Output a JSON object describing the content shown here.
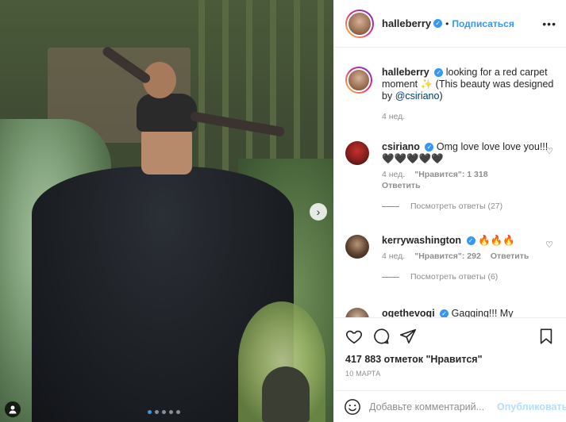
{
  "header": {
    "username": "halleberry",
    "separator": "•",
    "follow_label": "Подписаться",
    "more_label": "•••"
  },
  "caption": {
    "username": "halleberry",
    "text": "looking for a red carpet moment ✨ (This beauty was designed by ",
    "mention": "@csiriano",
    "text_end": ")",
    "time": "4 нед."
  },
  "comments": [
    {
      "username": "csiriano",
      "text": "Omg love love love you!!! 🖤🖤🖤🖤🖤",
      "time": "4 нед.",
      "likes": "\"Нравится\": 1 318",
      "reply": "Ответить",
      "view_replies": "Посмотреть ответы (27)"
    },
    {
      "username": "kerrywashington",
      "text": "🔥🔥🔥",
      "time": "4 нед.",
      "likes": "\"Нравится\": 292",
      "reply": "Ответить",
      "view_replies": "Посмотреть ответы (6)"
    },
    {
      "username": "ogethevogi",
      "text": "Gagging!!! My"
    }
  ],
  "post": {
    "likes": "417 883 отметок \"Нравится\"",
    "date": "10 МАРТА"
  },
  "composer": {
    "placeholder": "Добавьте комментарий...",
    "publish_label": "Опубликовать"
  },
  "icons": {
    "heart": "heart-icon",
    "comment": "comment-icon",
    "share": "share-icon",
    "bookmark": "bookmark-icon",
    "emoji": "emoji-icon",
    "next": "chevron-right-icon",
    "user_tag": "user-icon"
  },
  "colors": {
    "accent": "#3897f0",
    "text": "#262626",
    "muted": "#8e8e8e",
    "publish_disabled": "#b2dffc"
  },
  "carousel": {
    "slide_count": 5,
    "active_index": 0
  }
}
